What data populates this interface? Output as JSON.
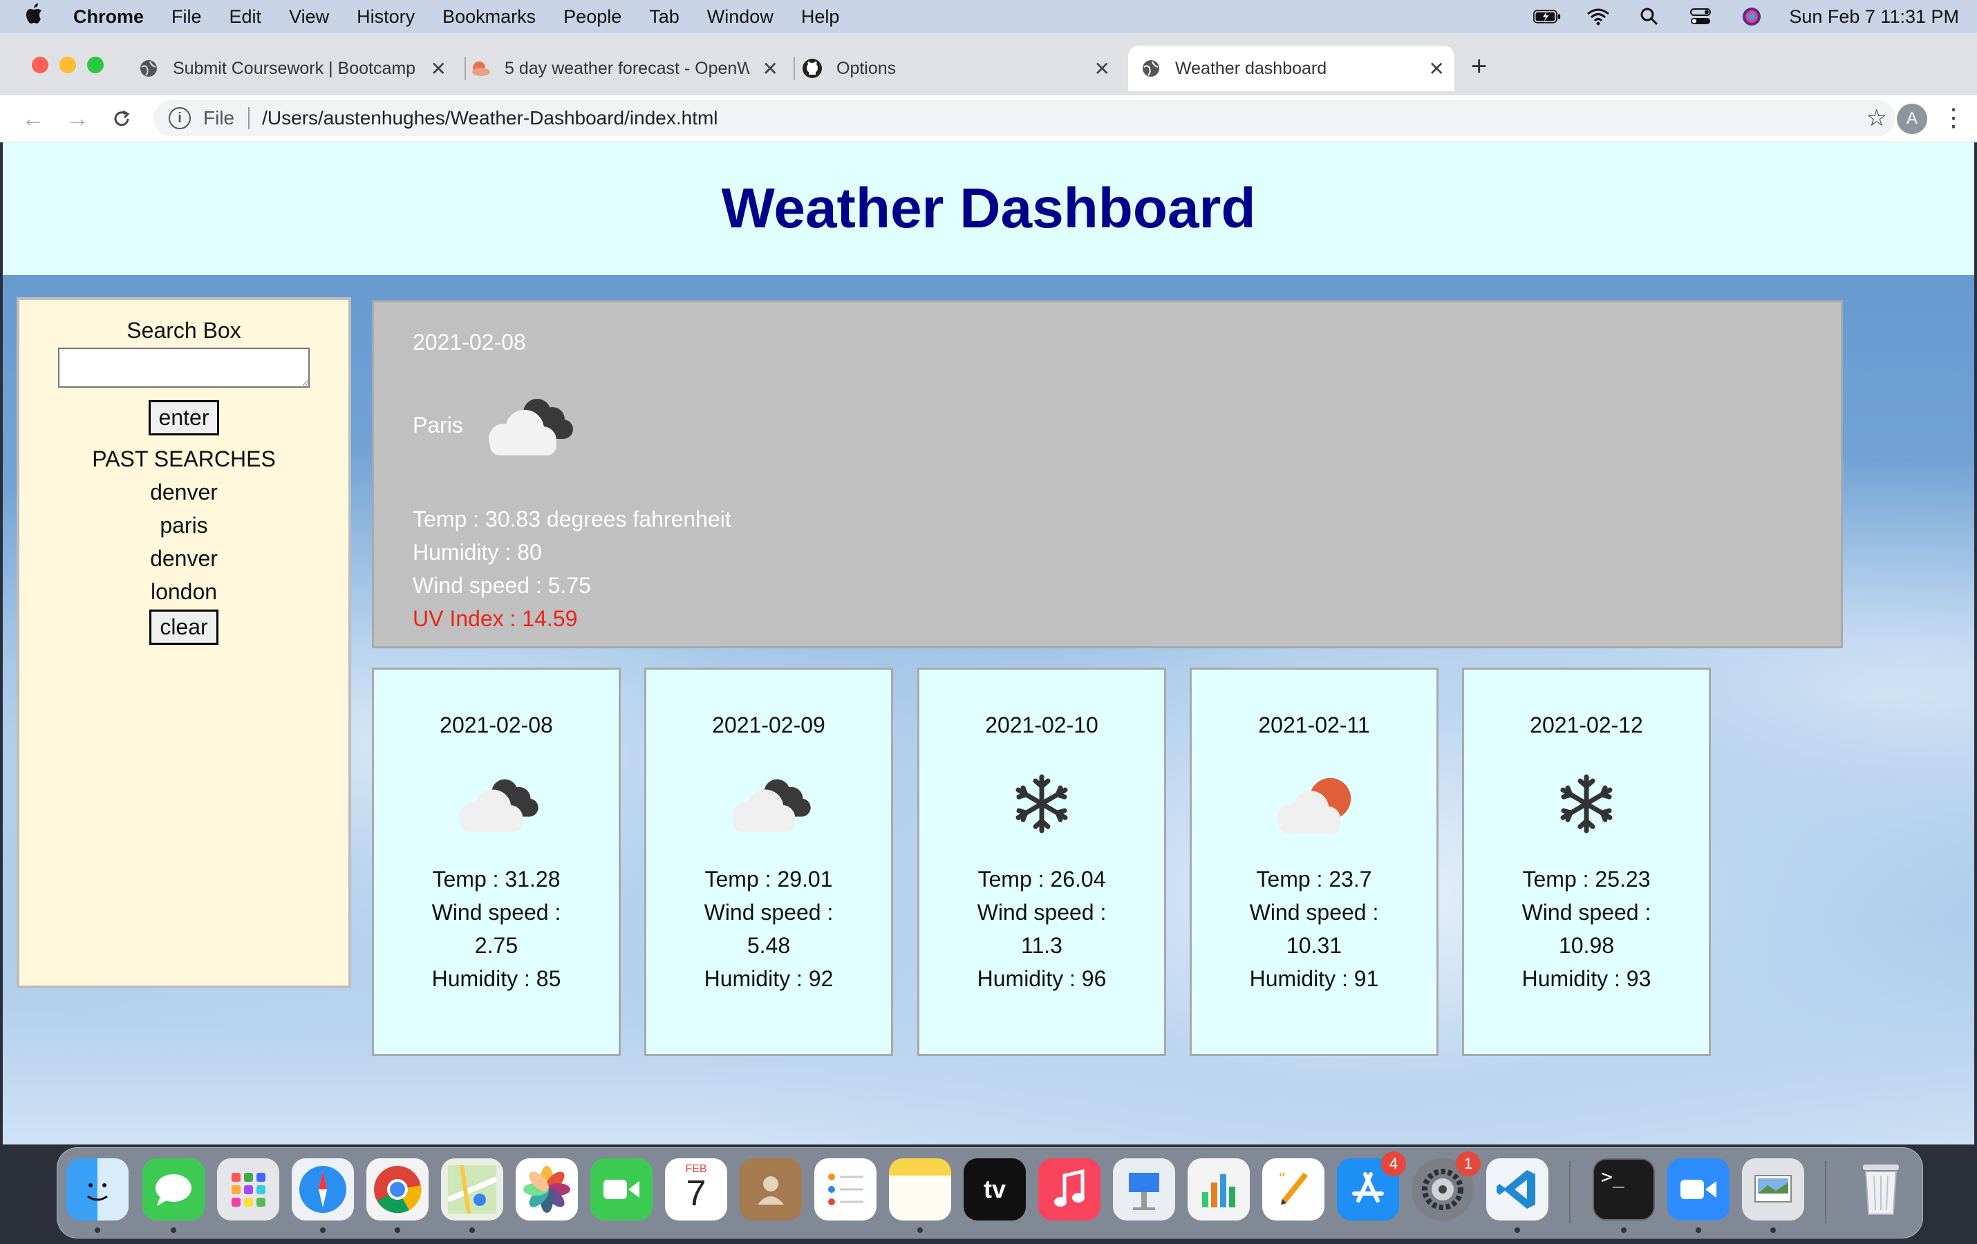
{
  "menubar": {
    "app": "Chrome",
    "items": [
      "File",
      "Edit",
      "View",
      "History",
      "Bookmarks",
      "People",
      "Tab",
      "Window",
      "Help"
    ],
    "clock": "Sun Feb 7  11:31 PM"
  },
  "tabs": [
    {
      "title": "Submit Coursework | Bootcamp",
      "icon": "globe-icon"
    },
    {
      "title": "5 day weather forecast - OpenW",
      "icon": "openweather-icon"
    },
    {
      "title": "Options",
      "icon": "github-icon"
    },
    {
      "title": "Weather dashboard",
      "icon": "globe-icon",
      "active": true
    }
  ],
  "address": {
    "scheme": "File",
    "path": "/Users/austenhughes/Weather-Dashboard/index.html"
  },
  "profile_initial": "A",
  "page": {
    "title": "Weather Dashboard",
    "sidebar": {
      "search_label": "Search Box",
      "search_value": "",
      "enter_label": "enter",
      "past_label": "PAST SEARCHES",
      "past_searches": [
        "denver",
        "paris",
        "denver",
        "london"
      ],
      "clear_label": "clear"
    },
    "current": {
      "date": "2021-02-08",
      "city": "Paris",
      "icon": "dark-cloud-icon",
      "temp": "Temp : 30.83 degrees fahrenheit",
      "humidity": "Humidity : 80",
      "wind": "Wind speed : 5.75",
      "uv": "UV Index : 14.59",
      "uv_color": "#e8251a"
    },
    "forecast": [
      {
        "date": "2021-02-08",
        "icon": "dark-cloud-icon",
        "temp": "Temp : 31.28",
        "wind_label": "Wind speed :",
        "wind": "2.75",
        "humidity": "Humidity : 85"
      },
      {
        "date": "2021-02-09",
        "icon": "dark-cloud-icon",
        "temp": "Temp : 29.01",
        "wind_label": "Wind speed :",
        "wind": "5.48",
        "humidity": "Humidity : 92"
      },
      {
        "date": "2021-02-10",
        "icon": "snowflake-icon",
        "temp": "Temp : 26.04",
        "wind_label": "Wind speed :",
        "wind": "11.3",
        "humidity": "Humidity : 96"
      },
      {
        "date": "2021-02-11",
        "icon": "sun-cloud-icon",
        "temp": "Temp : 23.7",
        "wind_label": "Wind speed :",
        "wind": "10.31",
        "humidity": "Humidity : 91"
      },
      {
        "date": "2021-02-12",
        "icon": "snowflake-icon",
        "temp": "Temp : 25.23",
        "wind_label": "Wind speed :",
        "wind": "10.98",
        "humidity": "Humidity : 93"
      }
    ]
  },
  "dock": {
    "calendar_month": "FEB",
    "calendar_day": "7",
    "appstore_badge": "4",
    "settings_badge": "1",
    "tv_label": "tv"
  },
  "colors": {
    "header_bg": "#e2ffff",
    "title": "#00008b",
    "sidebar_bg": "#fff8dc",
    "current_bg": "#c0c0c0",
    "card_bg": "#e2ffff"
  }
}
